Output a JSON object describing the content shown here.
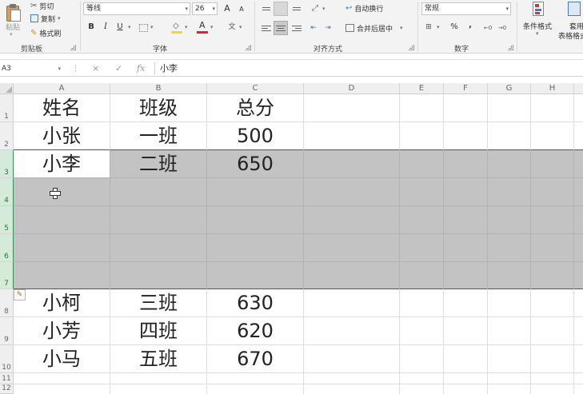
{
  "ribbon": {
    "clipboard": {
      "paste_label": "粘贴",
      "cut_label": "剪切",
      "copy_label": "复制",
      "format_painter_label": "格式刷",
      "group_label": "剪贴板"
    },
    "font": {
      "font_name": "等线",
      "font_size": "26",
      "bold": "B",
      "italic": "I",
      "underline": "U",
      "grow": "A",
      "shrink": "A",
      "font_color_glyph": "A",
      "phonetic": "文",
      "group_label": "字体"
    },
    "alignment": {
      "wrap_label": "自动换行",
      "merge_label": "合并后居中",
      "group_label": "对齐方式"
    },
    "number": {
      "format_value": "常规",
      "percent": "%",
      "comma": ",",
      "group_label": "数字"
    },
    "styles": {
      "conditional_label": "条件格式",
      "table_label_line1": "套用",
      "table_label_line2": "表格格式"
    }
  },
  "formula_bar": {
    "name_box": "A3",
    "cancel_symbol": "×",
    "enter_symbol": "✓",
    "fx_symbol": "fx",
    "content": "小李"
  },
  "sheet": {
    "columns": [
      "A",
      "B",
      "C",
      "D",
      "E",
      "F",
      "G",
      "H"
    ],
    "rows": [
      "1",
      "2",
      "3",
      "4",
      "5",
      "6",
      "7",
      "8",
      "9",
      "10",
      "11",
      "12"
    ],
    "selected_rows": [
      3,
      4,
      5,
      6,
      7
    ],
    "cells": [
      [
        "姓名",
        "班级",
        "总分"
      ],
      [
        "小张",
        "一班",
        "500"
      ],
      [
        "小李",
        "二班",
        "650"
      ],
      [
        "",
        "",
        ""
      ],
      [
        "",
        "",
        ""
      ],
      [
        "",
        "",
        ""
      ],
      [
        "",
        "",
        ""
      ],
      [
        "小柯",
        "三班",
        "630"
      ],
      [
        "小芳",
        "四班",
        "620"
      ],
      [
        "小马",
        "五班",
        "670"
      ]
    ]
  },
  "colors": {
    "accent_green": "#217346",
    "selection_gray": "#c3c3c3",
    "highlight_yellow": "#f5d14a",
    "font_red": "#d22a2a"
  }
}
